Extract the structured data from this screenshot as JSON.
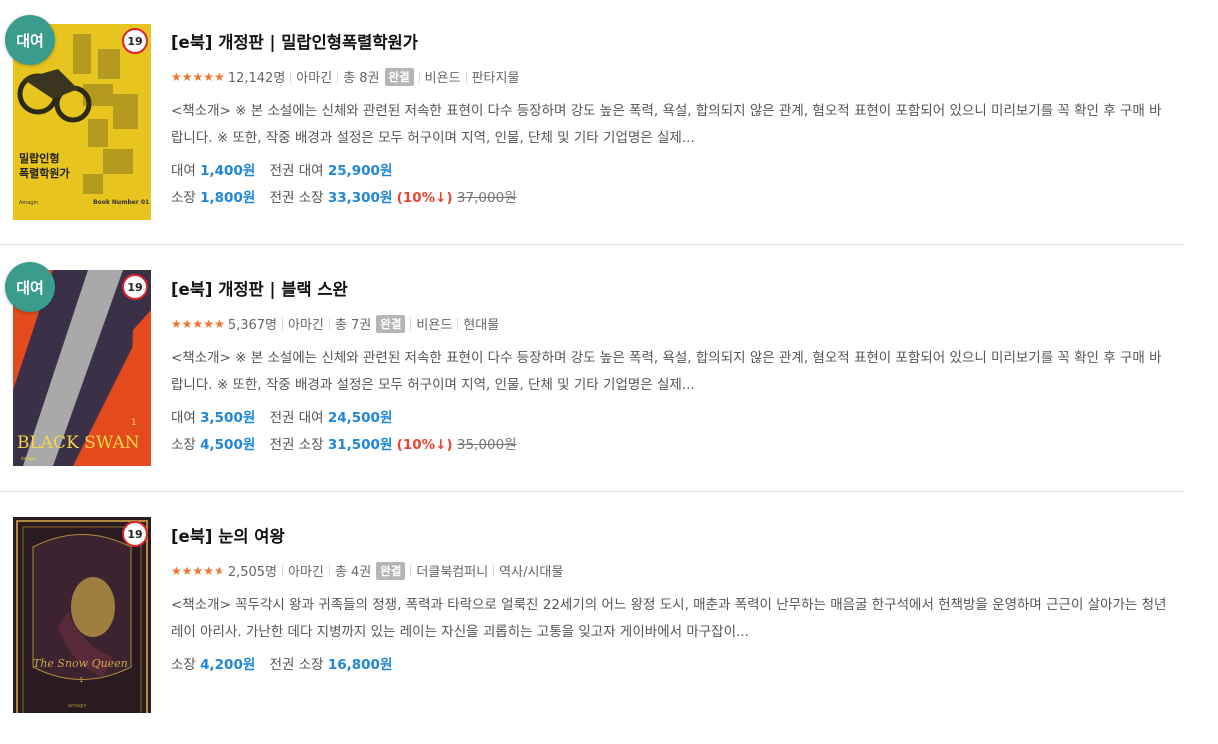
{
  "books": [
    {
      "rent_badge": "대여",
      "age_badge": "19",
      "cover_title_lines": [
        "밀랍인형",
        "폭렬학원가"
      ],
      "cover_sub": "Book Number 01",
      "cover_author": "Amagin",
      "title": "[e북] 개정판 | 밀랍인형폭렬학원가",
      "review_count": "12,142명",
      "author": "아마긴",
      "volumes": "총 8권",
      "status": "완결",
      "publisher": "비욘드",
      "genre": "판타지물",
      "description": "<책소개> ※ 본 소설에는 신체와 관련된 저속한 표현이 다수 등장하며 강도 높은 폭력, 욕설, 합의되지 않은 관계, 혐오적 표현이 포함되어 있으니 미리보기를 꼭 확인 후 구매 바랍니다. ※ 또한, 작중 배경과 설정은 모두 허구이며 지역, 인물, 단체 및 기타 기업명은 실제...",
      "rent_label": "대여",
      "rent_price": "1,400원",
      "rent_all_label": "전권 대여",
      "rent_all_price": "25,900원",
      "own_label": "소장",
      "own_price": "1,800원",
      "own_all_label": "전권 소장",
      "own_all_price": "33,300원",
      "discount": "(10%↓)",
      "original_price": "37,000원",
      "rating": 5
    },
    {
      "rent_badge": "대여",
      "age_badge": "19",
      "cover_title_lines": [
        "BLACK SWAN"
      ],
      "cover_sub": "1",
      "cover_author": "Amagin",
      "title": "[e북] 개정판 | 블랙 스완",
      "review_count": "5,367명",
      "author": "아마긴",
      "volumes": "총 7권",
      "status": "완결",
      "publisher": "비욘드",
      "genre": "현대물",
      "description": "<책소개> ※ 본 소설에는 신체와 관련된 저속한 표현이 다수 등장하며 강도 높은 폭력, 욕설, 합의되지 않은 관계, 혐오적 표현이 포함되어 있으니 미리보기를 꼭 확인 후 구매 바랍니다. ※ 또한, 작중 배경과 설정은 모두 허구이며 지역, 인물, 단체 및 기타 기업명은 실제...",
      "rent_label": "대여",
      "rent_price": "3,500원",
      "rent_all_label": "전권 대여",
      "rent_all_price": "24,500원",
      "own_label": "소장",
      "own_price": "4,500원",
      "own_all_label": "전권 소장",
      "own_all_price": "31,500원",
      "discount": "(10%↓)",
      "original_price": "35,000원",
      "rating": 5
    },
    {
      "age_badge": "19",
      "cover_title_lines": [
        "The Snow Queen"
      ],
      "cover_sub": "1",
      "cover_author": "amagin",
      "title": "[e북] 눈의 여왕",
      "review_count": "2,505명",
      "author": "아마긴",
      "volumes": "총 4권",
      "status": "완결",
      "publisher": "더클북컴퍼니",
      "genre": "역사/시대물",
      "description": "<책소개> 꼭두각시 왕과 귀족들의 정쟁, 폭력과 타락으로 얼룩진 22세기의 어느 왕정 도시, 매춘과 폭력이 난무하는 매음굴 한구석에서 헌책방을 운영하며 근근이 살아가는 청년 레이 아리사. 가난한 데다 지병까지 있는 레이는 자신을 괴롭히는 고통을 잊고자 게이바에서 마구잡이...",
      "own_label": "소장",
      "own_price": "4,200원",
      "own_all_label": "전권 소장",
      "own_all_price": "16,800원",
      "rating": 4.5
    }
  ],
  "colors": {
    "price_blue": "#1f86d9",
    "discount_red": "#e8452f",
    "star_orange": "#f3722c",
    "rent_badge_green": "#3a9c8c"
  }
}
